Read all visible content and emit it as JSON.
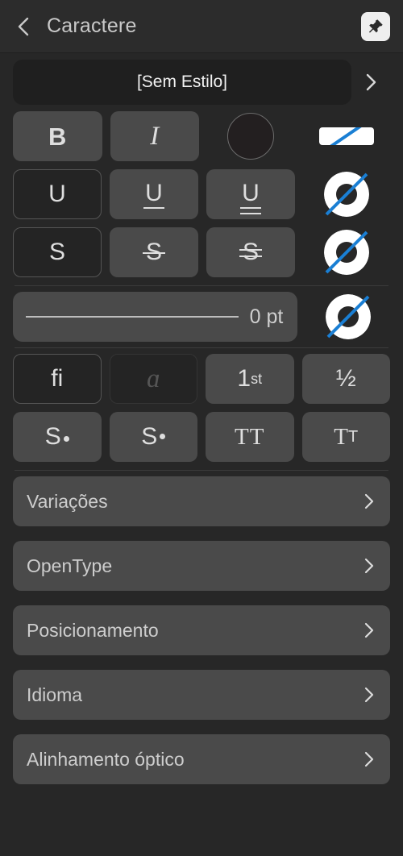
{
  "header": {
    "title": "Caractere",
    "back_icon": "chevron-left-icon",
    "pin_icon": "pushpin-icon"
  },
  "style_selector": {
    "label": "[Sem Estilo]",
    "chevron_icon": "chevron-right-icon"
  },
  "format_rows": [
    {
      "name": "weight-style-row",
      "buttons": [
        {
          "name": "bold-button",
          "label": "B",
          "style": "bold",
          "state": "normal"
        },
        {
          "name": "italic-button",
          "label": "I",
          "style": "italic",
          "state": "normal"
        },
        {
          "name": "text-color-swatch",
          "label": "",
          "style": "swatch",
          "state": "normal"
        },
        {
          "name": "text-fill-style-button",
          "label": "",
          "style": "paint-bar",
          "state": "normal"
        }
      ]
    },
    {
      "name": "underline-row",
      "buttons": [
        {
          "name": "underline-none-button",
          "label": "U",
          "style": "plain",
          "state": "selected"
        },
        {
          "name": "underline-single-button",
          "label": "U",
          "style": "underline-single",
          "state": "normal"
        },
        {
          "name": "underline-double-button",
          "label": "U",
          "style": "underline-double",
          "state": "normal"
        },
        {
          "name": "underline-color-button",
          "label": "",
          "style": "paint-ring",
          "state": "normal"
        }
      ]
    },
    {
      "name": "strikethrough-row",
      "buttons": [
        {
          "name": "strikethrough-none-button",
          "label": "S",
          "style": "plain",
          "state": "selected"
        },
        {
          "name": "strikethrough-single-button",
          "label": "S",
          "style": "strike-single",
          "state": "normal"
        },
        {
          "name": "strikethrough-double-button",
          "label": "S",
          "style": "strike-double",
          "state": "normal"
        },
        {
          "name": "strikethrough-color-button",
          "label": "",
          "style": "paint-ring",
          "state": "normal"
        }
      ]
    }
  ],
  "stroke_width": {
    "name": "stroke-width-field",
    "value": "0 pt",
    "ring_name": "stroke-color-button"
  },
  "typography_rows": [
    {
      "name": "ligature-row",
      "buttons": [
        {
          "name": "ligatures-button",
          "label": "fi",
          "style": "plain",
          "state": "selected"
        },
        {
          "name": "swash-alternates-button",
          "label": "ɑ",
          "style": "cursive",
          "state": "disabled"
        },
        {
          "name": "ordinals-button",
          "label": "1",
          "sup": "st",
          "style": "ordinal",
          "state": "normal"
        },
        {
          "name": "fractions-button",
          "label": "½",
          "style": "plain",
          "state": "normal"
        }
      ]
    },
    {
      "name": "script-position-row",
      "buttons": [
        {
          "name": "superscript-button",
          "label": "S",
          "dot": "super",
          "style": "script",
          "state": "normal"
        },
        {
          "name": "subscript-button",
          "label": "S",
          "dot": "sub",
          "style": "script",
          "state": "normal"
        },
        {
          "name": "all-caps-button",
          "label": "TT",
          "style": "serif",
          "state": "normal"
        },
        {
          "name": "small-caps-button",
          "label": "T",
          "sup": "T",
          "style": "smallcaps",
          "state": "normal"
        }
      ]
    }
  ],
  "menu_items": [
    {
      "name": "variations-row",
      "label": "Variações",
      "chevron_icon": "chevron-right-icon"
    },
    {
      "name": "opentype-row",
      "label": "OpenType",
      "chevron_icon": "chevron-right-icon"
    },
    {
      "name": "positioning-row",
      "label": "Posicionamento",
      "chevron_icon": "chevron-right-icon"
    },
    {
      "name": "language-row",
      "label": "Idioma",
      "chevron_icon": "chevron-right-icon"
    },
    {
      "name": "optical-alignment-row",
      "label": "Alinhamento óptico",
      "chevron_icon": "chevron-right-icon"
    }
  ],
  "colors": {
    "background": "#272727",
    "header": "#2c2c2c",
    "button": "#4a4a4a",
    "button_selected": "#242424",
    "accent_blue": "#1a7fd4",
    "paint_white": "#ffffff",
    "text": "#cdcdcd"
  }
}
